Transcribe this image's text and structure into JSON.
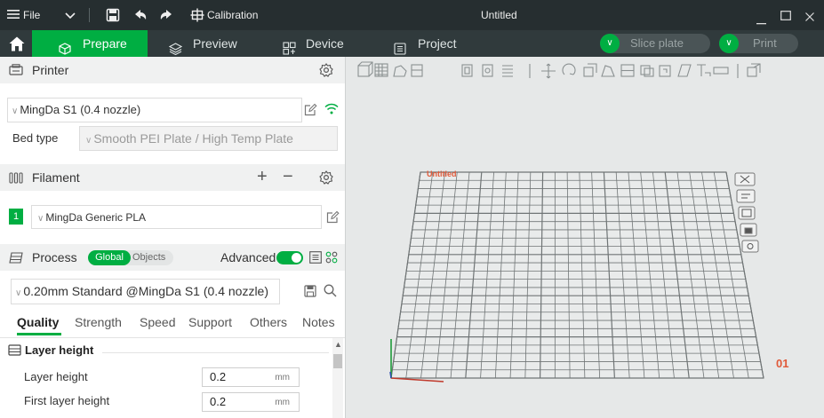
{
  "titlebar": {
    "file_label": "File",
    "calibration_label": "Calibration",
    "window_title": "Untitled"
  },
  "mainbar": {
    "tabs": [
      {
        "label": "Prepare"
      },
      {
        "label": "Preview"
      },
      {
        "label": "Device"
      },
      {
        "label": "Project"
      }
    ],
    "slice_label": "Slice plate",
    "print_label": "Print"
  },
  "printer": {
    "section_label": "Printer",
    "selected": "MingDa S1 (0.4 nozzle)",
    "bed_type_label": "Bed type",
    "bed_type_value": "Smooth PEI Plate / High Temp Plate"
  },
  "filament": {
    "section_label": "Filament",
    "items": [
      {
        "index": "1",
        "name": "MingDa Generic PLA",
        "color": "#00ae42"
      }
    ]
  },
  "process": {
    "section_label": "Process",
    "global_label": "Global",
    "objects_label": "Objects",
    "advanced_label": "Advanced",
    "advanced_on": true,
    "preset": "0.20mm Standard @MingDa S1 (0.4 nozzle)",
    "tabs": [
      "Quality",
      "Strength",
      "Speed",
      "Support",
      "Others",
      "Notes"
    ],
    "active_tab": "Quality",
    "group_label": "Layer height",
    "params": [
      {
        "label": "Layer height",
        "value": "0.2",
        "unit": "mm"
      },
      {
        "label": "First layer height",
        "value": "0.2",
        "unit": "mm"
      }
    ]
  },
  "viewport": {
    "plate_title": "Untitled",
    "plate_number": "01"
  },
  "colors": {
    "accent": "#00ae42",
    "titlebar_bg": "#262e30",
    "toolbar_bg": "#303a3c",
    "viewport_bg": "#e6e8e8",
    "plate_label": "#e05a3a"
  }
}
